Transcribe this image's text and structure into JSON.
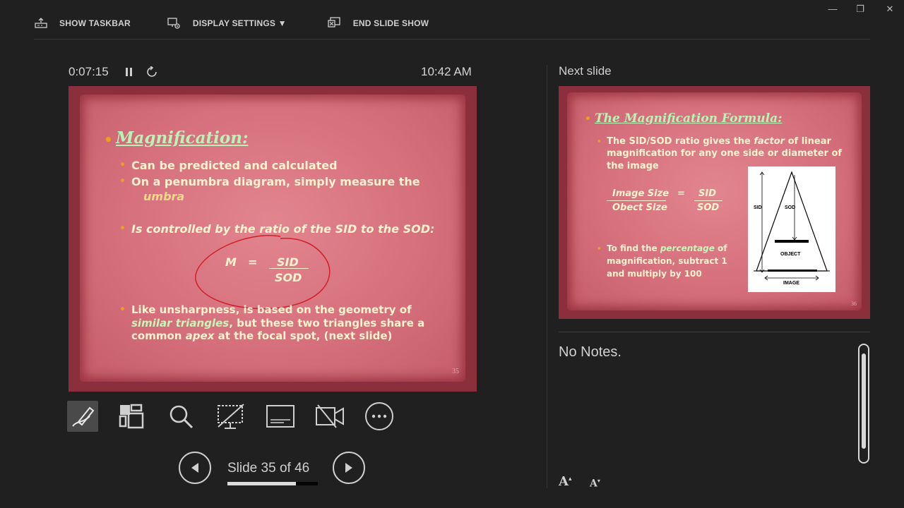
{
  "toolbar": {
    "show_taskbar": "SHOW TASKBAR",
    "display_settings": "DISPLAY SETTINGS ▼",
    "end_slide_show": "END SLIDE SHOW"
  },
  "window": {
    "minimize": "—",
    "restore": "❐",
    "close": "✕"
  },
  "timer": {
    "elapsed": "0:07:15",
    "clock": "10:42 AM"
  },
  "current_slide": {
    "title": "Magnification:",
    "b1": "Can be predicted and calculated",
    "b2_a": "On a penumbra diagram, simply measure the",
    "b2_b": "umbra",
    "b3": "Is controlled by the ratio of the SID to the SOD:",
    "formula_m": "M",
    "formula_eq": "=",
    "formula_num": "SID",
    "formula_den": "SOD",
    "b4_a": "Like unsharpness, is based on the geometry of",
    "b4_b1": "similar triangles",
    "b4_b2": ", but these two triangles share a",
    "b4_c1": "common ",
    "b4_c2": "apex",
    "b4_c3": " at the focal spot, (next slide)",
    "number": "35",
    "annotation_color": "#d0202a"
  },
  "tools": [
    "pen-icon",
    "see-all-slides-icon",
    "zoom-icon",
    "black-screen-icon",
    "subtitles-icon",
    "camera-off-icon",
    "more-options-icon"
  ],
  "navigation": {
    "counter": "Slide 35 of 46",
    "progress": 0.76
  },
  "next_slide": {
    "label": "Next slide",
    "title": "The Magnification Formula:",
    "p1_a": "The SID/SOD ratio gives the ",
    "p1_b": "factor",
    "p1_c": " of linear",
    "p1_d": "magnification for any one side or diameter of",
    "p1_e": "the image",
    "f_num": "Image Size",
    "f_den": "Obect Size",
    "f_eq": "=",
    "f_num2": "SID",
    "f_den2": "SOD",
    "p2_a": "To find the ",
    "p2_b": "percentage",
    "p2_c": " of",
    "p2_d": "magnification, subtract 1",
    "p2_e": "and multiply by 100",
    "diagram": {
      "sid": "SID",
      "sod": "SOD",
      "object": "OBJECT",
      "image": "IMAGE"
    },
    "number": "36"
  },
  "notes": {
    "text": "No Notes."
  },
  "font_controls": {
    "increase": "A",
    "decrease": "A"
  }
}
